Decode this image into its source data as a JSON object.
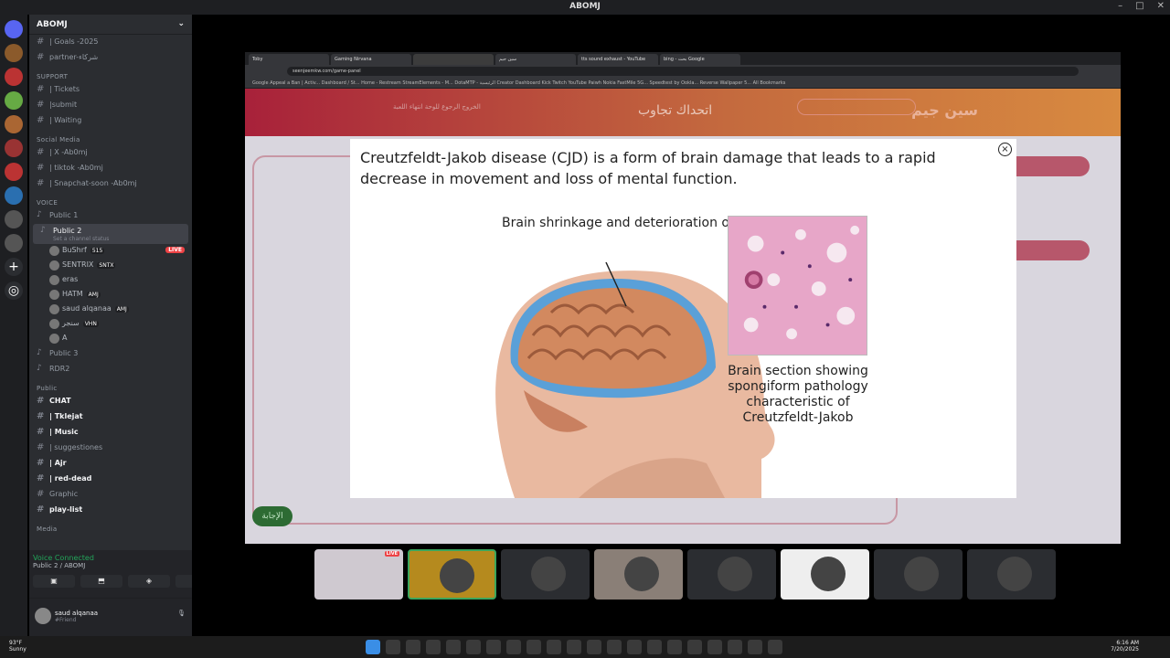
{
  "window": {
    "title": "ABOMJ"
  },
  "guild": {
    "name": "ABOMJ"
  },
  "channels": {
    "top": [
      "| Goals -2025",
      "partner-شركاء"
    ],
    "support_label": "SUPPORT",
    "support": [
      "| Tickets",
      "|submit",
      "| Waiting"
    ],
    "social_label": "Social Media",
    "social": [
      "| X -Ab0mj",
      "| tiktok -Ab0mj",
      "| Snapchat-soon -Ab0mj"
    ],
    "voice_label": "VOICE",
    "voice1": "Public 1",
    "voice2": "Public 2",
    "voice2_status": "Set a channel status",
    "members": [
      {
        "name": "BuShrf",
        "tag": "515"
      },
      {
        "name": "SENTRIX",
        "tag": "SNTX"
      },
      {
        "name": "eras",
        "tag": ""
      },
      {
        "name": "HATM",
        "tag": "AMJ"
      },
      {
        "name": "saud alqanaa",
        "tag": "AMJ"
      },
      {
        "name": "سنجر",
        "tag": "VHN"
      },
      {
        "name": "A",
        "tag": ""
      }
    ],
    "live_label": "LIVE",
    "voice3": "Public 3",
    "rdr2": "RDR2",
    "public_label": "Public",
    "public": [
      "CHAT",
      "| Tklejat",
      "| Music",
      "| suggestiones",
      "| Ajr",
      "| red-dead",
      "Graphic",
      "play-list"
    ],
    "media_label": "Media"
  },
  "voice_connected": {
    "status": "Voice Connected",
    "where": "Public 2 / ABOMJ"
  },
  "user": {
    "name": "saud alqanaa",
    "status": "#Friend"
  },
  "browser": {
    "tabs": [
      "Toby",
      "Gaming Nirvana",
      "",
      "سين جيم",
      "tts sound exhaust - YouTube",
      "bing - بحث Google"
    ],
    "url": "seenjeemkw.com/game-panel",
    "bookmarks": "Google   Appeal a Ban | Activ...   Dashboard / St...   Home - Restream   StreamElements - M...   DotaMTP - الرئيسية   Creator Dashboard   Kick   Twitch   YouTube   Paiwh   Nokia FastMile 5G...   Speedtest by Ookla...   Reverse Wallpaper 5...   All Bookmarks"
  },
  "site": {
    "title": "اتحداك تجاوب",
    "links": "الخروج    الرجوع للوحة    انتهاء اللعبة",
    "answer": "الإجابة",
    "logo": "سين جيم"
  },
  "modal": {
    "question": "Creutzfeldt-Jakob disease (CJD) is a form of brain damage that leads to a rapid decrease in movement and loss of mental function.",
    "caption_left": "Brain shrinkage and deterioration occurs rapidly",
    "caption_right": "Brain section showing spongiform pathology characteristic of Creutzfeldt-Jakob",
    "close": "×"
  },
  "thumbs": {
    "live": "LIVE"
  },
  "taskbar": {
    "temp": "93°F",
    "weather": "Sunny",
    "time": "6:16 AM",
    "date": "7/20/2025"
  }
}
